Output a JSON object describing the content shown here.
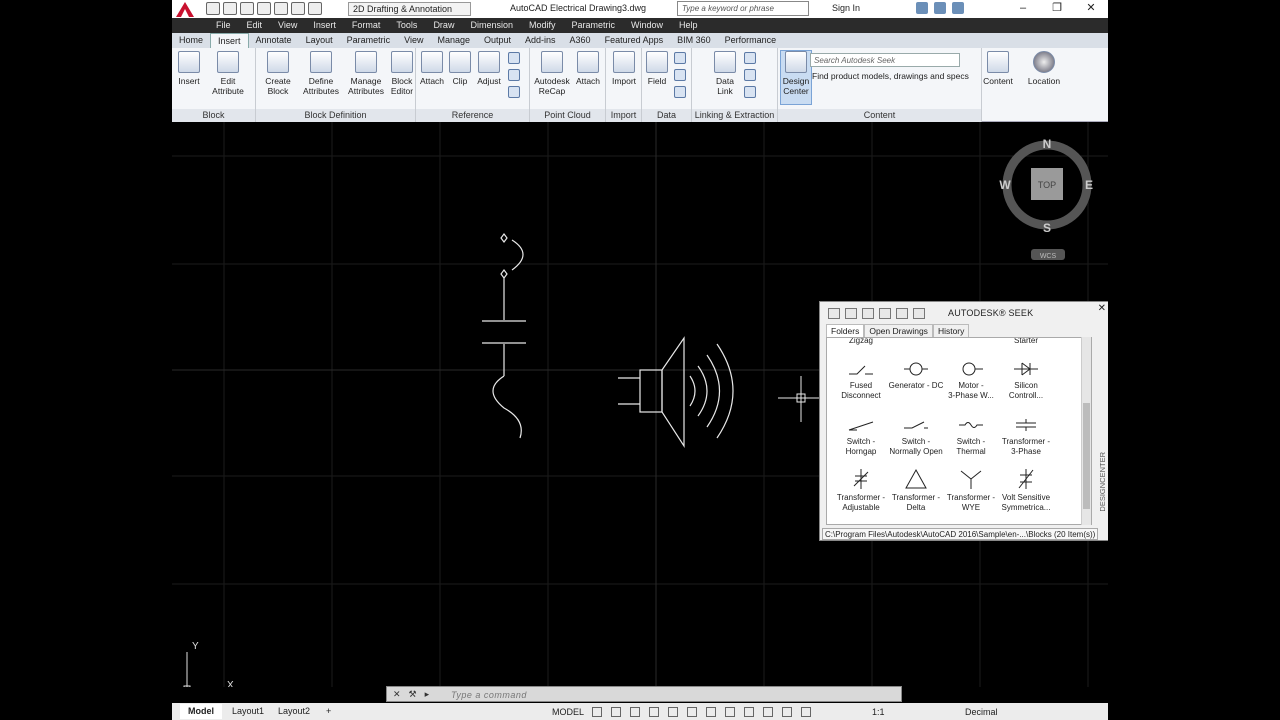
{
  "titlebar": {
    "workspace": "2D Drafting & Annotation",
    "app_title": "AutoCAD Electrical    Drawing3.dwg",
    "search_placeholder": "Type a keyword or phrase",
    "signin": "Sign In"
  },
  "menubar": [
    "File",
    "Edit",
    "View",
    "Insert",
    "Format",
    "Tools",
    "Draw",
    "Dimension",
    "Modify",
    "Parametric",
    "Window",
    "Help"
  ],
  "tabs": [
    "Home",
    "Insert",
    "Annotate",
    "Layout",
    "Parametric",
    "View",
    "Manage",
    "Output",
    "Add-ins",
    "A360",
    "Featured Apps",
    "BIM 360",
    "Performance"
  ],
  "active_tab": "Insert",
  "ribbon": {
    "insert": "Insert",
    "edit_attribute": "Edit\nAttribute",
    "create_block": "Create\nBlock",
    "define_attributes": "Define\nAttributes",
    "manage_attributes": "Manage\nAttributes",
    "block_editor": "Block\nEditor",
    "attach": "Attach",
    "clip": "Clip",
    "adjust": "Adjust",
    "autodesk_recap": "Autodesk\nReCap",
    "attach_pc": "Attach",
    "import": "Import",
    "field": "Field",
    "data_link": "Data\nLink",
    "design_center": "Design\nCenter",
    "seek_placeholder": "Search Autodesk Seek",
    "seek_text": "Find product models, drawings and specs",
    "content": "Content",
    "location": "Location",
    "panels": [
      "Block",
      "Block Definition",
      "Reference",
      "Point Cloud",
      "Import",
      "Data",
      "Linking & Extraction",
      "Content"
    ]
  },
  "viewcube": {
    "n": "N",
    "s": "S",
    "e": "E",
    "w": "W",
    "top": "TOP",
    "wcs": "WCS"
  },
  "ucs": {
    "x": "X",
    "y": "Y"
  },
  "designcenter": {
    "seek_title": "AUTODESK® SEEK",
    "tabs": [
      "Folders",
      "Open Drawings",
      "History"
    ],
    "partial_top": [
      "Zigzag",
      "Starter"
    ],
    "items": [
      {
        "label": "Fused\nDisconnect",
        "icon": "fused-disconnect-icon"
      },
      {
        "label": "Generator - DC",
        "icon": "generator-dc-icon"
      },
      {
        "label": "Motor -\n3-Phase W...",
        "icon": "motor-3phase-icon"
      },
      {
        "label": "Silicon\nControll...",
        "icon": "silicon-controlled-icon"
      },
      {
        "label": "Switch -\nHorngap",
        "icon": "switch-horngap-icon"
      },
      {
        "label": "Switch -\nNormally Open",
        "icon": "switch-normally-open-icon"
      },
      {
        "label": "Switch -\nThermal",
        "icon": "switch-thermal-icon"
      },
      {
        "label": "Transformer -\n3-Phase",
        "icon": "transformer-3phase-icon"
      },
      {
        "label": "Transformer -\nAdjustable",
        "icon": "transformer-adjustable-icon"
      },
      {
        "label": "Transformer -\nDelta",
        "icon": "transformer-delta-icon"
      },
      {
        "label": "Transformer -\nWYE",
        "icon": "transformer-wye-icon"
      },
      {
        "label": "Volt Sensitive\nSymmetrica...",
        "icon": "volt-sensitive-icon"
      }
    ],
    "side_label": "DESIGNCENTER",
    "status": "C:\\Program Files\\Autodesk\\AutoCAD 2016\\Sample\\en-...\\Blocks (20 Item(s))"
  },
  "commandline": {
    "placeholder": "Type a command"
  },
  "statusbar": {
    "layout_tabs": [
      "Model",
      "Layout1",
      "Layout2"
    ],
    "model": "MODEL",
    "scale": "1:1",
    "units": "Decimal"
  }
}
